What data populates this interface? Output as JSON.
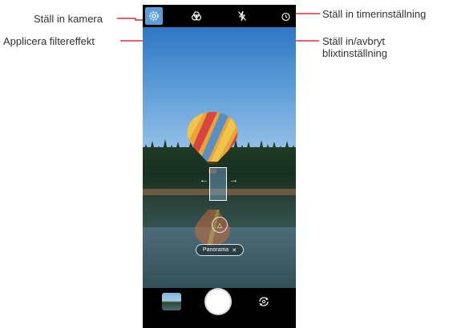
{
  "callouts": {
    "camera_settings": "Ställ in kamera",
    "filter_effect": "Applicera filtereffekt",
    "flash_line1": "Ställ in/avbryt",
    "flash_line2": "blixtinställning",
    "timer": "Ställ in timerinställning"
  },
  "toolbar": {
    "settings_icon": "gear-icon",
    "filter_icon": "filter-icon",
    "flash_icon": "flash-off-icon",
    "timer_icon": "timer-icon",
    "active_color": "#5b9fd6"
  },
  "viewfinder": {
    "mode_label": "Panorama",
    "mode_close": "✕"
  },
  "bottom": {
    "gallery_icon": "gallery-thumbnail",
    "shutter_icon": "shutter-button",
    "switch_icon": "switch-camera-icon"
  },
  "colors": {
    "callout_line": "#e0001b"
  }
}
